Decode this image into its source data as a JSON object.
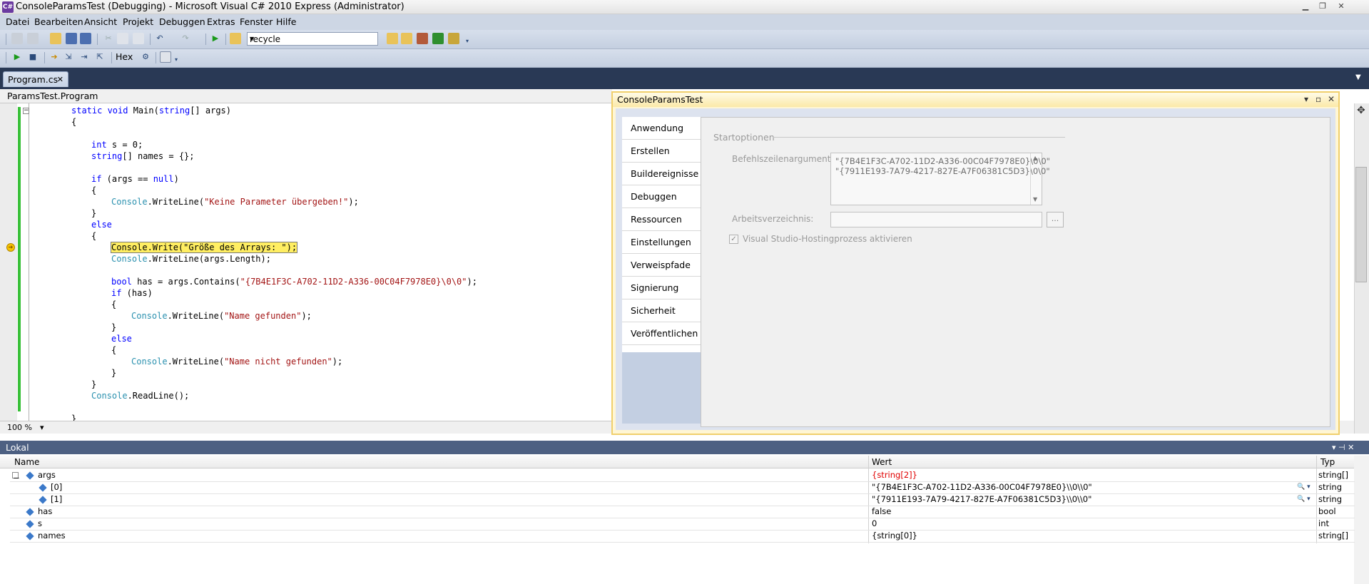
{
  "window": {
    "title": "ConsoleParamsTest (Debugging) - Microsoft Visual C# 2010 Express (Administrator)",
    "app_icon": "C#",
    "minimize": "▁",
    "restore": "❐",
    "close": "✕"
  },
  "menu": [
    "Datei",
    "Bearbeiten",
    "Ansicht",
    "Projekt",
    "Debuggen",
    "Extras",
    "Fenster",
    "Hilfe"
  ],
  "toolbar": {
    "config_value": "recycle",
    "hex_label": "Hex"
  },
  "editor": {
    "tab_label": "Program.cs",
    "tab_close": "✕",
    "nav_path": "ParamsTest.Program",
    "zoom": "100 %",
    "zoom_arrow": "▾",
    "collapse_glyph": "−",
    "lines": {
      "l0": "static void Main(string[] args)",
      "l1": "{",
      "l3": "int s = 0;",
      "l4": "string[] names = {};",
      "l6": "if (args == null)",
      "l7": "{",
      "l8": "Console.WriteLine(\"Keine Parameter übergeben!\");",
      "l9": "}",
      "l10": "else",
      "l11": "{",
      "l12": "Console.Write(\"Größe des Arrays: \");",
      "l13": "Console.WriteLine(args.Length);",
      "l15": "bool has = args.Contains(\"{7B4E1F3C-A702-11D2-A336-00C04F7978E0}\\0\\0\");",
      "l16": "if (has)",
      "l17": "{",
      "l18": "Console.WriteLine(\"Name gefunden\");",
      "l19": "}",
      "l20": "else",
      "l21": "{",
      "l22": "Console.WriteLine(\"Name nicht gefunden\");",
      "l23": "}",
      "l24": "}",
      "l25": "Console.ReadLine();",
      "l27": "}"
    },
    "tokens": {
      "static_void": "static void",
      "main_sig": " Main(",
      "string_kw": "string",
      "args_sig": "[] args)",
      "int_kw": "int",
      "s_decl": " s = 0;",
      "names_decl": "[] names = {};",
      "if_kw": "if",
      "args_null": " (args == ",
      "null_kw": "null",
      "close_paren": ")",
      "console": "Console",
      "writeline_open": ".WriteLine(",
      "str_keine": "\"Keine Parameter übergeben!\"",
      "close_stmt": ");",
      "else_kw": "else",
      "write_open": ".Write(",
      "str_groesse": "\"Größe des Arrays: \"",
      "writeline_len": ".WriteLine(args.Length);",
      "bool_kw": "bool",
      "has_contains": " has = args.Contains(",
      "str_guid": "\"{7B4E1F3C-A702-11D2-A336-00C04F7978E0}\\0\\0\"",
      "if_has": " (has)",
      "str_gefunden": "\"Name gefunden\"",
      "str_nicht": "\"Name nicht gefunden\"",
      "readline": ".ReadLine();"
    }
  },
  "project_window": {
    "title": "ConsoleParamsTest",
    "controls": [
      "▾",
      "▫",
      "✕"
    ],
    "tabs": [
      "Anwendung",
      "Erstellen",
      "Buildereignisse",
      "Debuggen",
      "Ressourcen",
      "Einstellungen",
      "Verweispfade",
      "Signierung",
      "Sicherheit",
      "Veröffentlichen"
    ],
    "active_tab": "Debuggen",
    "section": "Startoptionen",
    "cmdline_label": "Befehlszeilenargumente:",
    "cmdline_lines": [
      "\"{7B4E1F3C-A702-11D2-A336-00C04F7978E0}\\0\\0\"",
      "\"{7911E193-7A79-4217-827E-A7F06381C5D3}\\0\\0\""
    ],
    "workdir_label": "Arbeitsverzeichnis:",
    "workdir_value": "",
    "browse_label": "...",
    "hosting_checkbox_label": "Visual Studio-Hostingprozess aktivieren",
    "hosting_checked": true,
    "check_glyph": "✓"
  },
  "locals": {
    "title": "Lokal",
    "pin_glyph": "▾  ⊣  ✕",
    "columns": [
      "Name",
      "Wert",
      "Typ"
    ],
    "rows": [
      {
        "name": "args",
        "value": "{string[2]}",
        "type": "string[]",
        "expanded": true,
        "indent": 0,
        "changed": true,
        "exp": "−"
      },
      {
        "name": "[0]",
        "value": "\"{7B4E1F3C-A702-11D2-A336-00C04F7978E0}\\\\0\\\\0\"",
        "type": "string",
        "indent": 1,
        "viz": "🔍 ▾"
      },
      {
        "name": "[1]",
        "value": "\"{7911E193-7A79-4217-827E-A7F06381C5D3}\\\\0\\\\0\"",
        "type": "string",
        "indent": 1,
        "viz": "🔍 ▾"
      },
      {
        "name": "has",
        "value": "false",
        "type": "bool",
        "indent": 0
      },
      {
        "name": "s",
        "value": "0",
        "type": "int",
        "indent": 0
      },
      {
        "name": "names",
        "value": "{string[0]}",
        "type": "string[]",
        "indent": 0
      }
    ]
  },
  "colors": {
    "keyword": "#0000ff",
    "string": "#a31515",
    "type": "#2b91af",
    "changed_value": "#e00000",
    "current_statement": "#ffee62"
  }
}
